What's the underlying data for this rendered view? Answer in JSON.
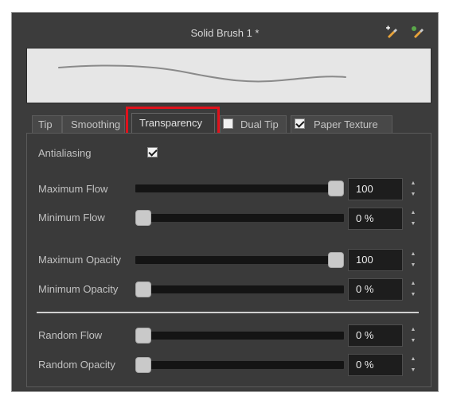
{
  "header": {
    "title": "Solid Brush 1 *",
    "icons": [
      "brush-add-icon",
      "brush-settings-icon"
    ]
  },
  "tabs": [
    {
      "label": "Tip"
    },
    {
      "label": "Smoothing"
    },
    {
      "label": "Transparency",
      "active": true
    },
    {
      "label": "Dual Tip",
      "checkbox": false
    },
    {
      "label": "Paper Texture",
      "checkbox": true
    }
  ],
  "settings": {
    "antialiasing_label": "Antialiasing",
    "antialiasing_checked": true,
    "maximum_flow": {
      "label": "Maximum Flow",
      "value": "100",
      "level": 1.0
    },
    "minimum_flow": {
      "label": "Minimum Flow",
      "value": "0 %",
      "level": 0.0
    },
    "maximum_opacity": {
      "label": "Maximum Opacity",
      "value": "100",
      "level": 1.0
    },
    "minimum_opacity": {
      "label": "Minimum Opacity",
      "value": "0 %",
      "level": 0.0
    },
    "random_flow": {
      "label": "Random Flow",
      "value": "0 %",
      "level": 0.0
    },
    "random_opacity": {
      "label": "Random Opacity",
      "value": "0 %",
      "level": 0.0
    }
  },
  "colors": {
    "panel_bg": "#3c3c3c",
    "highlight": "#e0111b"
  }
}
